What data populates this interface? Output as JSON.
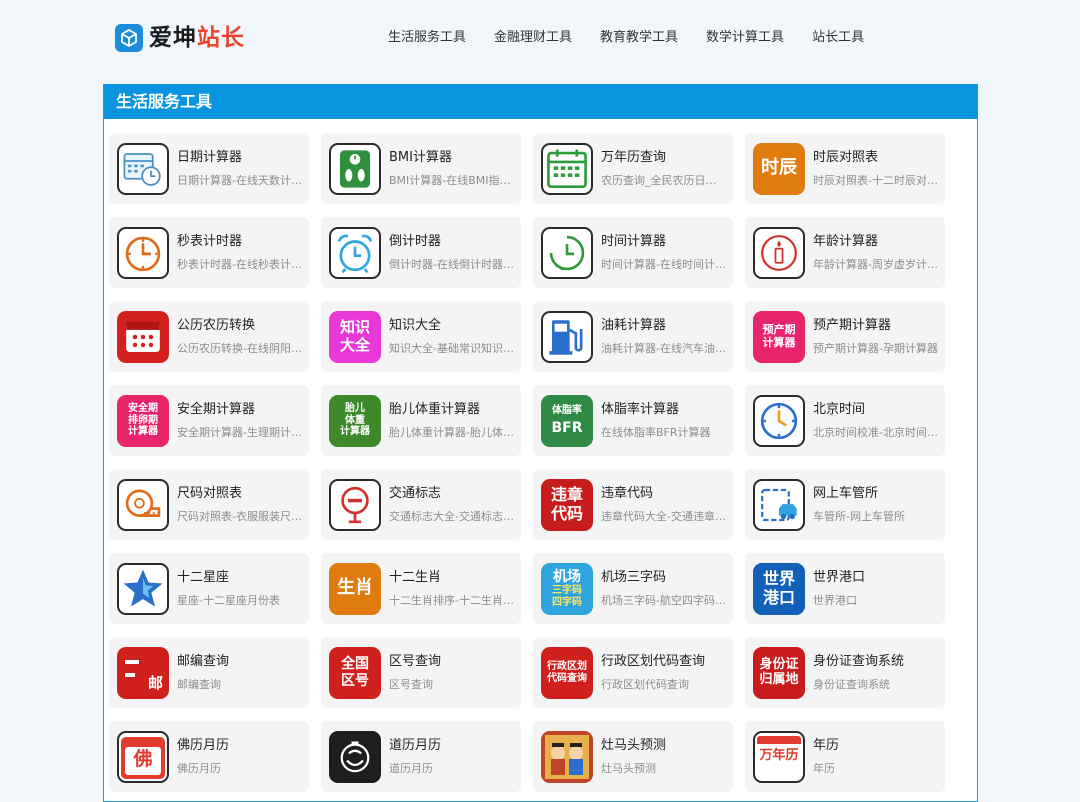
{
  "header": {
    "logo_part1": "爱坤",
    "logo_part2": "站长",
    "nav": [
      "生活服务工具",
      "金融理财工具",
      "教育教学工具",
      "数学计算工具",
      "站长工具"
    ]
  },
  "section": {
    "title": "生活服务工具"
  },
  "colors": {
    "brand_blue": "#0a94e0",
    "logo_red": "#e8452c",
    "card_bg": "#f4f4f4"
  },
  "tools": [
    {
      "title": "日期计算器",
      "desc": "日期计算器-在线天数计算器",
      "icon": "calendar-clock-icon"
    },
    {
      "title": "BMI计算器",
      "desc": "BMI计算器-在线BMI指数计算",
      "icon": "bmi-scale-icon"
    },
    {
      "title": "万年历查询",
      "desc": "农历查询_全民农历日历查询",
      "icon": "calendar-grid-icon"
    },
    {
      "title": "时辰对照表",
      "desc": "时辰对照表-十二时辰对照表",
      "icon": "shichen-icon",
      "icon_text": "时辰"
    },
    {
      "title": "秒表计时器",
      "desc": "秒表计时器-在线秒表计时器",
      "icon": "stopwatch-icon"
    },
    {
      "title": "倒计时器",
      "desc": "倒计时器-在线倒计时器工具",
      "icon": "alarm-clock-icon"
    },
    {
      "title": "时间计算器",
      "desc": "时间计算器-在线时间计算器",
      "icon": "time-clock-icon"
    },
    {
      "title": "年龄计算器",
      "desc": "年龄计算器-周岁虚岁计算器",
      "icon": "candle-icon"
    },
    {
      "title": "公历农历转换",
      "desc": "公历农历转换-在线阴阳历转换",
      "icon": "calendar-convert-icon"
    },
    {
      "title": "知识大全",
      "desc": "知识大全-基础常识知识大全",
      "icon": "knowledge-icon",
      "icon_text": [
        "知识",
        "大全"
      ]
    },
    {
      "title": "油耗计算器",
      "desc": "油耗计算器-在线汽车油耗计算",
      "icon": "fuel-pump-icon"
    },
    {
      "title": "预产期计算器",
      "desc": "预产期计算器-孕期计算器",
      "icon": "due-date-icon",
      "icon_text": [
        "预产期",
        "计算器"
      ]
    },
    {
      "title": "安全期计算器",
      "desc": "安全期计算器-生理期计算器",
      "icon": "safe-period-icon",
      "icon_text": [
        "安全期",
        "排卵期",
        "计算器"
      ]
    },
    {
      "title": "胎儿体重计算器",
      "desc": "胎儿体重计算器-胎儿体重计算",
      "icon": "fetal-weight-icon",
      "icon_text": [
        "胎儿",
        "体重",
        "计算器"
      ]
    },
    {
      "title": "体脂率计算器",
      "desc": "在线体脂率BFR计算器",
      "icon": "bfr-icon",
      "icon_text": [
        "体脂率",
        "BFR"
      ]
    },
    {
      "title": "北京时间",
      "desc": "北京时间校准-北京时间在线",
      "icon": "beijing-clock-icon"
    },
    {
      "title": "尺码对照表",
      "desc": "尺码对照表-衣服服装尺码对照",
      "icon": "tape-measure-icon"
    },
    {
      "title": "交通标志",
      "desc": "交通标志大全-交通标志图解",
      "icon": "traffic-sign-icon"
    },
    {
      "title": "违章代码",
      "desc": "违章代码大全-交通违章代码",
      "icon": "violation-code-icon",
      "icon_text": [
        "违章",
        "代码"
      ]
    },
    {
      "title": "网上车管所",
      "desc": "车管所-网上车管所",
      "icon": "vehicle-office-icon"
    },
    {
      "title": "十二星座",
      "desc": "星座-十二星座月份表",
      "icon": "star-icon"
    },
    {
      "title": "十二生肖",
      "desc": "十二生肖排序-十二生肖查询",
      "icon": "zodiac-icon",
      "icon_text": "生肖"
    },
    {
      "title": "机场三字码",
      "desc": "机场三字码-航空四字码查询",
      "icon": "airport-code-icon",
      "icon_text": [
        "机场",
        "三字码",
        "四字码"
      ]
    },
    {
      "title": "世界港口",
      "desc": "世界港口",
      "icon": "world-port-icon",
      "icon_text": [
        "世界",
        "港口"
      ]
    },
    {
      "title": "邮编查询",
      "desc": "邮编查询",
      "icon": "postcode-icon",
      "icon_text": "邮"
    },
    {
      "title": "区号查询",
      "desc": "区号查询",
      "icon": "area-code-icon",
      "icon_text": [
        "全国",
        "区号"
      ]
    },
    {
      "title": "行政区划代码查询",
      "desc": "行政区划代码查询",
      "icon": "admin-code-icon",
      "icon_text": [
        "行政区划",
        "代码查询"
      ]
    },
    {
      "title": "身份证查询系统",
      "desc": "身份证查询系统",
      "icon": "id-card-icon",
      "icon_text": [
        "身份证",
        "归属地"
      ]
    },
    {
      "title": "佛历月历",
      "desc": "佛历月历",
      "icon": "buddhist-calendar-icon",
      "icon_text": "佛"
    },
    {
      "title": "道历月历",
      "desc": "道历月历",
      "icon": "taoist-calendar-icon"
    },
    {
      "title": "灶马头预测",
      "desc": "灶马头预测",
      "icon": "kitchen-god-icon"
    },
    {
      "title": "年历",
      "desc": "年历",
      "icon": "year-calendar-icon",
      "icon_text": "万年历"
    }
  ]
}
